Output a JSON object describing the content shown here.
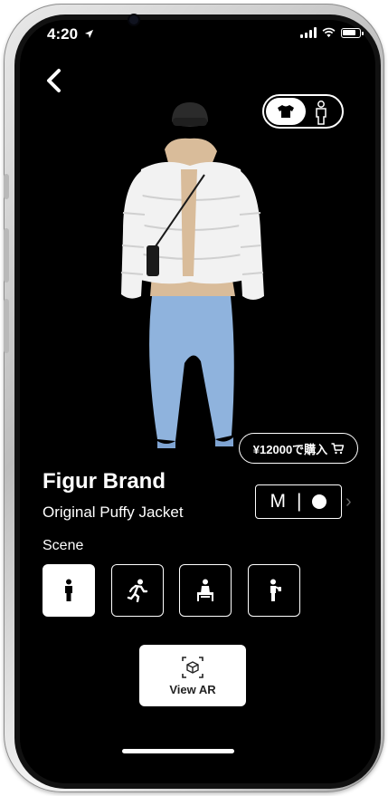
{
  "status": {
    "time": "4:20"
  },
  "product": {
    "brand": "Figur Brand",
    "name": "Original Puffy Jacket",
    "price_label": "¥12000で購入",
    "size": "M",
    "size_separator": "|"
  },
  "scene": {
    "label": "Scene",
    "options": [
      {
        "icon": "standing-person-icon",
        "selected": true
      },
      {
        "icon": "running-person-icon",
        "selected": false
      },
      {
        "icon": "sitting-person-icon",
        "selected": false
      },
      {
        "icon": "person-with-phone-icon",
        "selected": false
      }
    ]
  },
  "ar_button": {
    "label": "View AR",
    "icon": "ar-cube-icon"
  },
  "view_toggle": {
    "selected": "clothing",
    "options": [
      "shirt-icon",
      "person-icon"
    ]
  },
  "colors": {
    "background": "#000000",
    "foreground": "#ffffff",
    "jacket": "#f2f2f2",
    "pants": "#8fb3dd",
    "hoodie": "#d9bc9a",
    "beanie": "#2b2b2b"
  }
}
